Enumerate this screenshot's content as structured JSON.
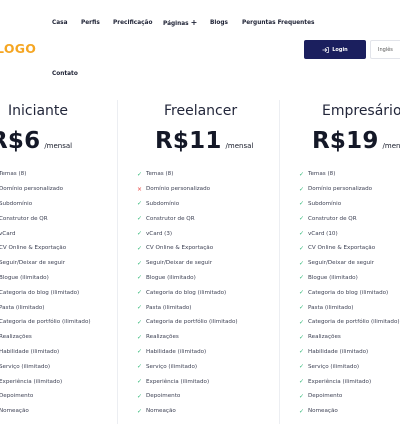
{
  "nav": {
    "items": [
      "Casa",
      "Perfis",
      "Precificação",
      "Páginas",
      "Blogs",
      "Perguntas Frequentes",
      "Contato"
    ],
    "pages_plus": "+"
  },
  "logo": "LOGO",
  "header": {
    "login_label": "Login",
    "login_icon": "login-arrow-icon",
    "language": "Inglês"
  },
  "colors": {
    "accent": "#f5a623",
    "primary": "#1b1f5e",
    "check": "#2bb673",
    "cross": "#e53935"
  },
  "plans": [
    {
      "name": "Iniciante",
      "price": "R$6",
      "period": "/mensal",
      "features": [
        {
          "label": "Temas (8)",
          "included": true
        },
        {
          "label": "Domínio personalizado",
          "included": true
        },
        {
          "label": "Subdomínio",
          "included": true
        },
        {
          "label": "Construtor de QR",
          "included": true
        },
        {
          "label": "vCard",
          "included": true
        },
        {
          "label": "CV Online & Exportação",
          "included": true
        },
        {
          "label": "Seguir/Deixar de seguir",
          "included": true
        },
        {
          "label": "Blogue (ilimitado)",
          "included": true
        },
        {
          "label": "Categoria do blog (ilimitado)",
          "included": true
        },
        {
          "label": "Pasta (ilimitado)",
          "included": true
        },
        {
          "label": "Categoria de portfólio (ilimitado)",
          "included": true
        },
        {
          "label": "Realizações",
          "included": true
        },
        {
          "label": "Habilidade (ilimitado)",
          "included": true
        },
        {
          "label": "Serviço (ilimitado)",
          "included": true
        },
        {
          "label": "Experiência (ilimitado)",
          "included": true
        },
        {
          "label": "Depoimento",
          "included": true
        },
        {
          "label": "Nomeação",
          "included": true
        }
      ]
    },
    {
      "name": "Freelancer",
      "price": "R$11",
      "period": "/mensal",
      "features": [
        {
          "label": "Temas (8)",
          "included": true
        },
        {
          "label": "Domínio personalizado",
          "included": false
        },
        {
          "label": "Subdomínio",
          "included": true
        },
        {
          "label": "Construtor de QR",
          "included": true
        },
        {
          "label": "vCard (3)",
          "included": true
        },
        {
          "label": "CV Online & Exportação",
          "included": true
        },
        {
          "label": "Seguir/Deixar de seguir",
          "included": true
        },
        {
          "label": "Blogue (ilimitado)",
          "included": true
        },
        {
          "label": "Categoria do blog (ilimitado)",
          "included": true
        },
        {
          "label": "Pasta (ilimitado)",
          "included": true
        },
        {
          "label": "Categoria de portfólio (ilimitado)",
          "included": true
        },
        {
          "label": "Realizações",
          "included": true
        },
        {
          "label": "Habilidade (ilimitado)",
          "included": true
        },
        {
          "label": "Serviço (ilimitado)",
          "included": true
        },
        {
          "label": "Experiência (ilimitado)",
          "included": true
        },
        {
          "label": "Depoimento",
          "included": true
        },
        {
          "label": "Nomeação",
          "included": true
        }
      ]
    },
    {
      "name": "Empresário",
      "price": "R$19",
      "period": "/mensal",
      "features": [
        {
          "label": "Temas (8)",
          "included": true
        },
        {
          "label": "Domínio personalizado",
          "included": true
        },
        {
          "label": "Subdomínio",
          "included": true
        },
        {
          "label": "Construtor de QR",
          "included": true
        },
        {
          "label": "vCard (10)",
          "included": true
        },
        {
          "label": "CV Online & Exportação",
          "included": true
        },
        {
          "label": "Seguir/Deixar de seguir",
          "included": true
        },
        {
          "label": "Blogue (ilimitado)",
          "included": true
        },
        {
          "label": "Categoria do blog (ilimitado)",
          "included": true
        },
        {
          "label": "Pasta (ilimitado)",
          "included": true
        },
        {
          "label": "Categoria de portfólio (ilimitado)",
          "included": true
        },
        {
          "label": "Realizações",
          "included": true
        },
        {
          "label": "Habilidade (ilimitado)",
          "included": true
        },
        {
          "label": "Serviço (ilimitado)",
          "included": true
        },
        {
          "label": "Experiência (ilimitado)",
          "included": true
        },
        {
          "label": "Depoimento",
          "included": true
        },
        {
          "label": "Nomeação",
          "included": true
        }
      ]
    }
  ]
}
